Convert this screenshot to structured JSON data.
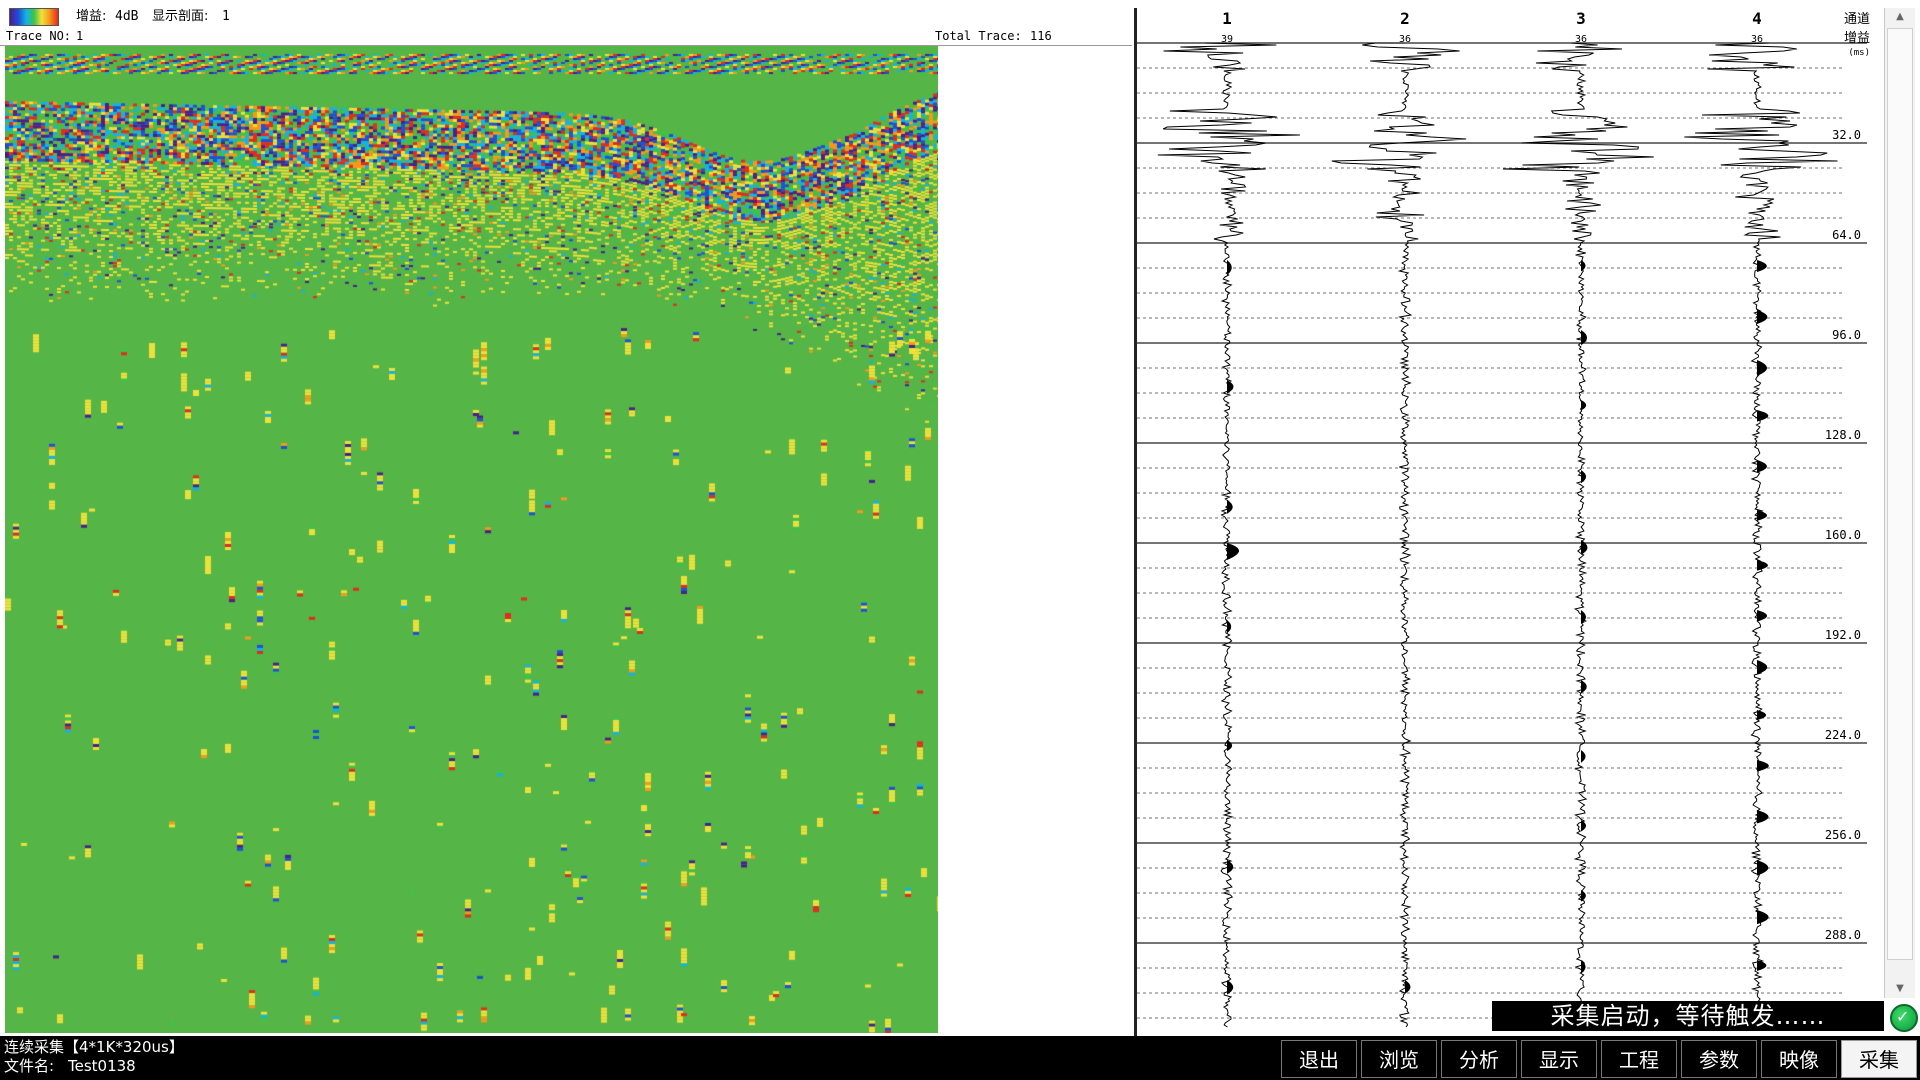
{
  "header": {
    "gain_label": "增益:",
    "gain_value": "4dB",
    "profile_label": "显示剖面:",
    "profile_value": "1",
    "trace_no_label": "Trace NO:",
    "trace_no_value": "1",
    "total_trace_label": "Total Trace:",
    "total_trace_value": "116"
  },
  "palette_icon": "color-palette-icon",
  "colors": {
    "profile_background": "#55b547",
    "palette": [
      "#4a1f8c",
      "#1f4fd8",
      "#12b4e6",
      "#3ec24a",
      "#f0e03a",
      "#f59a1c",
      "#e42a1f"
    ],
    "status_indicator": "#1bbf4f"
  },
  "waveform_panel": {
    "channel_header_label": "通道",
    "gain_header_label": "增益",
    "unit_label": "(ms)",
    "channels": [
      {
        "number": "1",
        "gain": "39"
      },
      {
        "number": "2",
        "gain": "36"
      },
      {
        "number": "3",
        "gain": "36"
      },
      {
        "number": "4",
        "gain": "36"
      }
    ],
    "time_axis": {
      "unit": "ms",
      "range": [
        0,
        320
      ],
      "major_step": 32,
      "minor_step": 8,
      "labels": [
        "32.0",
        "64.0",
        "96.0",
        "128.0",
        "160.0",
        "192.0",
        "224.0",
        "256.0",
        "288.0"
      ]
    }
  },
  "status": {
    "trigger_text": "采集启动，等待触发……",
    "indicator_icon": "status-ok-icon"
  },
  "footer": {
    "mode_text": "连续采集【4*1K*320us】",
    "filename_label": "文件名:",
    "filename_value": "Test0138"
  },
  "buttons": [
    {
      "name": "exit-button",
      "label": "退出"
    },
    {
      "name": "browse-button",
      "label": "浏览"
    },
    {
      "name": "analyze-button",
      "label": "分析"
    },
    {
      "name": "display-button",
      "label": "显示"
    },
    {
      "name": "project-button",
      "label": "工程"
    },
    {
      "name": "parameters-button",
      "label": "参数"
    },
    {
      "name": "image-button",
      "label": "映像"
    },
    {
      "name": "acquire-button",
      "label": "采集",
      "active": true
    }
  ]
}
